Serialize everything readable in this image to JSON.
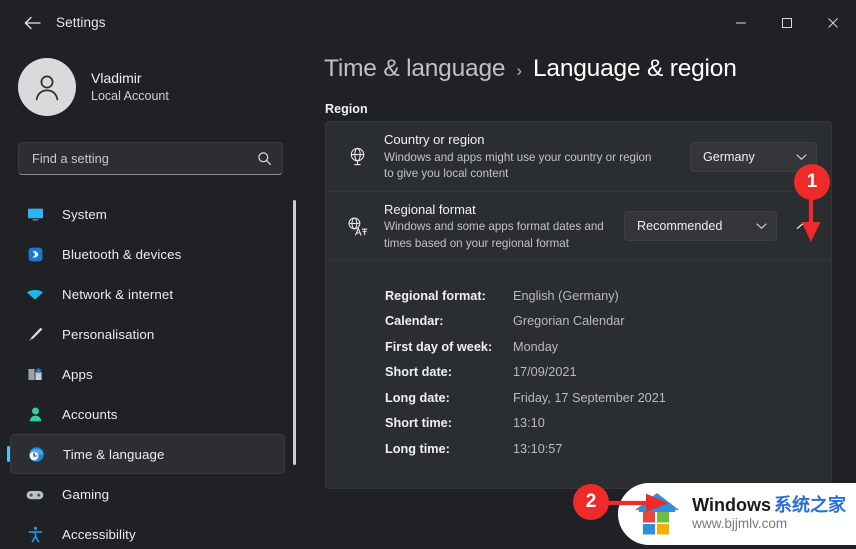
{
  "window": {
    "title": "Settings",
    "back_icon": "back-arrow-icon",
    "minimize_label": "Minimize",
    "maximize_label": "Maximize",
    "close_label": "Close"
  },
  "account": {
    "name": "Vladimir",
    "type": "Local Account",
    "avatar_icon": "person-avatar-icon"
  },
  "search": {
    "placeholder": "Find a setting",
    "value": "",
    "icon": "search-icon"
  },
  "sidebar": {
    "items": [
      {
        "label": "System",
        "icon": "monitor-icon",
        "selected": false
      },
      {
        "label": "Bluetooth & devices",
        "icon": "bluetooth-icon",
        "selected": false
      },
      {
        "label": "Network & internet",
        "icon": "wifi-icon",
        "selected": false
      },
      {
        "label": "Personalisation",
        "icon": "paintbrush-icon",
        "selected": false
      },
      {
        "label": "Apps",
        "icon": "apps-icon",
        "selected": false
      },
      {
        "label": "Accounts",
        "icon": "accounts-icon",
        "selected": false
      },
      {
        "label": "Time & language",
        "icon": "clock-globe-icon",
        "selected": true
      },
      {
        "label": "Gaming",
        "icon": "gamepad-icon",
        "selected": false
      },
      {
        "label": "Accessibility",
        "icon": "accessibility-icon",
        "selected": false
      }
    ]
  },
  "breadcrumb": {
    "parent": "Time & language",
    "separator": "›",
    "current": "Language & region"
  },
  "region_section": {
    "label": "Region"
  },
  "cards": {
    "country": {
      "icon": "globe-icon",
      "title": "Country or region",
      "description": "Windows and apps might use your country or region to give you local content",
      "dropdown_value": "Germany",
      "dropdown_icon": "chevron-down-icon"
    },
    "regional_format": {
      "icon": "globe-language-icon",
      "title": "Regional format",
      "description": "Windows and some apps format dates and times based on your regional format",
      "dropdown_value": "Recommended",
      "dropdown_icon": "chevron-down-icon",
      "expander_icon": "chevron-up-icon",
      "expanded": true
    }
  },
  "details": [
    {
      "label": "Regional format:",
      "value": "English (Germany)"
    },
    {
      "label": "Calendar:",
      "value": "Gregorian Calendar"
    },
    {
      "label": "First day of week:",
      "value": "Monday"
    },
    {
      "label": "Short date:",
      "value": "17/09/2021"
    },
    {
      "label": "Long date:",
      "value": "Friday, 17 September 2021"
    },
    {
      "label": "Short time:",
      "value": "13:10"
    },
    {
      "label": "Long time:",
      "value": "13:10:57"
    }
  ],
  "annotations": [
    {
      "number": "1",
      "target": "regional-format-expander"
    },
    {
      "number": "2",
      "target": "watermark"
    }
  ],
  "watermark": {
    "brand_en": "Windows",
    "brand_cn": "系统之家",
    "url": "www.bjjmlv.com",
    "logo_icon": "windows-house-logo-icon"
  },
  "colors": {
    "window_bg": "#202124",
    "card_bg": "#2b2e31",
    "dropdown_bg": "#343639",
    "accent_blue": "#4cc2ff",
    "annotation_red": "#ef2a2a",
    "watermark_bg": "#ffffff",
    "watermark_cn_blue": "#2b6fd4"
  }
}
